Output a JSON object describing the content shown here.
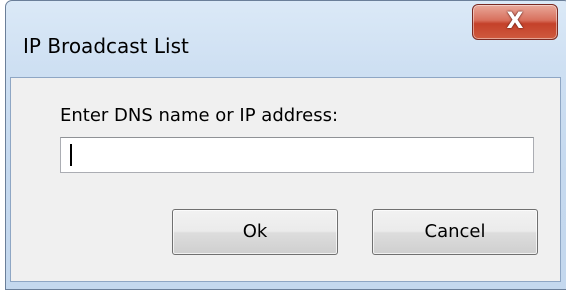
{
  "dialog": {
    "title": "IP Broadcast List",
    "close_label": "X",
    "prompt": "Enter DNS name or IP address:",
    "address_value": "",
    "ok_label": "Ok",
    "cancel_label": "Cancel"
  },
  "icons": {
    "close": "close-icon"
  },
  "colors": {
    "titlebar": "#c5d9ef",
    "close_button": "#c4412a",
    "client_background": "#f0f0f0",
    "button_border": "#707070"
  }
}
